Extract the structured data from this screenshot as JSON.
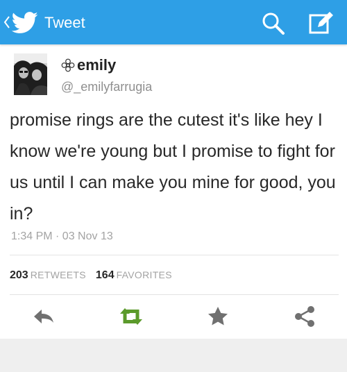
{
  "app_bar": {
    "title": "Tweet",
    "icons": [
      "back-chevron-icon",
      "twitter-bird-icon",
      "search-icon",
      "compose-icon"
    ],
    "background_color": "#2e9fe6"
  },
  "tweet": {
    "display_name": "emily",
    "handle": "@_emilyfarrugia",
    "text": "promise rings are the cutest it's like hey I know we're young but I promise to fight for us until I can make you mine for good, you in?",
    "timestamp": "1:34 PM · 03 Nov 13",
    "retweets": {
      "count": "203",
      "label": "RETWEETS"
    },
    "favorites": {
      "count": "164",
      "label": "FAVORITES"
    }
  },
  "actions": [
    "reply-icon",
    "retweet-icon",
    "favorite-icon",
    "share-icon"
  ],
  "colors": {
    "retweet_green": "#5b9a2b",
    "action_gray": "#707070"
  }
}
